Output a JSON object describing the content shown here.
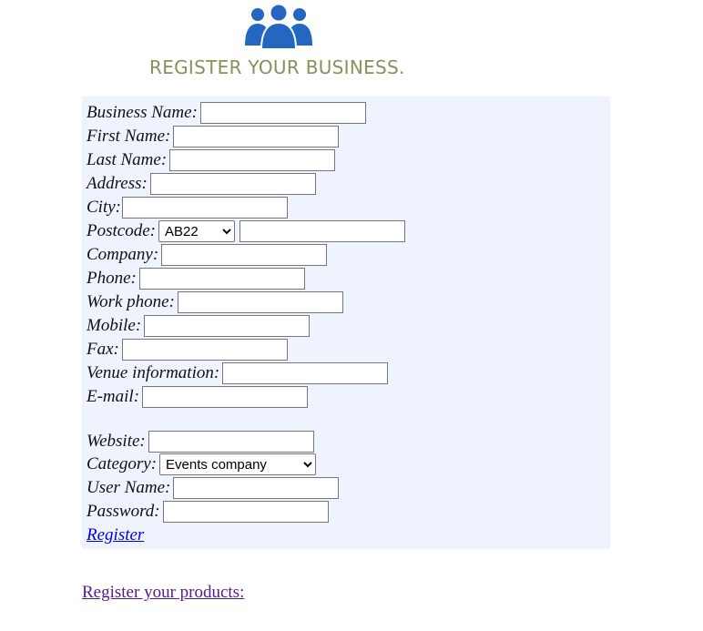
{
  "header": {
    "title": "REGISTER YOUR BUSINESS.",
    "logo_icon": "users-group-icon",
    "logo_color": "#2466c0"
  },
  "form": {
    "background": "#eef3fd",
    "fields": {
      "business_name": {
        "label": "Business Name:",
        "value": ""
      },
      "first_name": {
        "label": "First Name:",
        "value": ""
      },
      "last_name": {
        "label": "Last Name:",
        "value": ""
      },
      "address": {
        "label": "Address:",
        "value": ""
      },
      "city": {
        "label": "City:",
        "value": ""
      },
      "postcode": {
        "label": "Postcode:",
        "selected": "AB22",
        "value": ""
      },
      "company": {
        "label": "Company:",
        "value": ""
      },
      "phone": {
        "label": "Phone:",
        "value": ""
      },
      "work_phone": {
        "label": "Work phone:",
        "value": ""
      },
      "mobile": {
        "label": "Mobile:",
        "value": ""
      },
      "fax": {
        "label": "Fax:",
        "value": ""
      },
      "venue_information": {
        "label": "Venue information:",
        "value": ""
      },
      "email": {
        "label": "E-mail:",
        "value": ""
      },
      "website": {
        "label": "Website:",
        "value": ""
      },
      "category": {
        "label": "Category:",
        "selected": "Events company"
      },
      "user_name": {
        "label": "User Name:",
        "value": ""
      },
      "password": {
        "label": "Password:",
        "value": ""
      }
    },
    "register_link": "Register"
  },
  "footer": {
    "products_link": "Register your products:"
  }
}
